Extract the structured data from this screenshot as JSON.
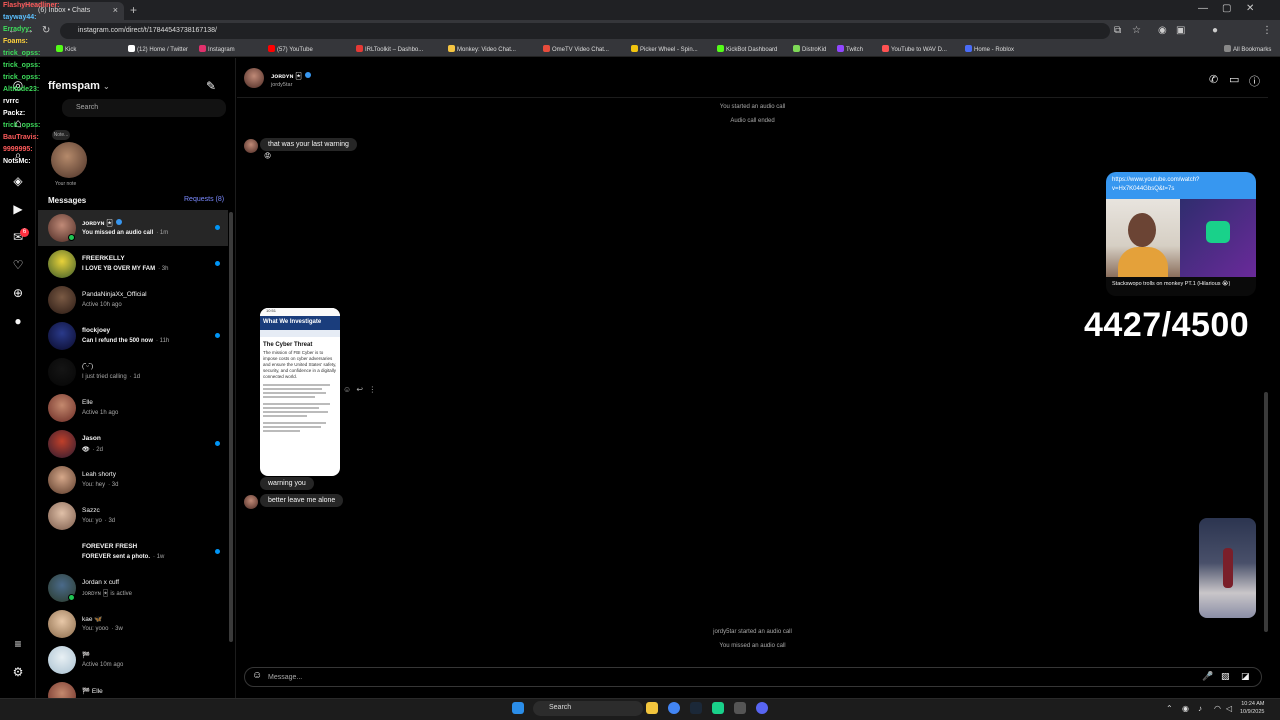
{
  "browser": {
    "tab_title": "(6) Inbox • Chats",
    "new_tab": "+",
    "url": "instagram.com/direct/t/17844543738167138/",
    "bookmarks": [
      {
        "label": "Kick",
        "color": "#53fc18"
      },
      {
        "label": "(12) Home / Twitter",
        "color": "#ffffff"
      },
      {
        "label": "Instagram",
        "color": "#e1306c"
      },
      {
        "label": "(57) YouTube",
        "color": "#ff0000"
      },
      {
        "label": "IRLToolkit – Dashbo...",
        "color": "#e53935"
      },
      {
        "label": "Monkey: Video Chat...",
        "color": "#f5c542"
      },
      {
        "label": "OmeTV Video Chat...",
        "color": "#e74c3c"
      },
      {
        "label": "Picker Wheel - Spin...",
        "color": "#f1c40f"
      },
      {
        "label": "KickBot Dashboard",
        "color": "#53fc18"
      },
      {
        "label": "DistroKid",
        "color": "#7ed957"
      },
      {
        "label": "Twitch",
        "color": "#9146ff"
      },
      {
        "label": "YouTube to WAV D...",
        "color": "#ff5252"
      },
      {
        "label": "Home - Roblox",
        "color": "#4a6cf7"
      }
    ],
    "all_bookmarks": "All Bookmarks"
  },
  "stream_chat": [
    {
      "name": "FlashyHeadliner:",
      "color": "#ff5b5b"
    },
    {
      "name": "tayway44:",
      "color": "#5bc0ff"
    },
    {
      "name": "Erradyy:",
      "color": "#3ddc5b"
    },
    {
      "name": "Foams:",
      "color": "#ffd23d"
    },
    {
      "name": "trick_opss:",
      "color": "#3ddc5b"
    },
    {
      "name": "trick_opss:",
      "color": "#3ddc5b"
    },
    {
      "name": "trick_opss:",
      "color": "#3ddc5b"
    },
    {
      "name": "Altitude23:",
      "color": "#3ddc5b"
    },
    {
      "name": "rvrrc",
      "color": "#ffffff"
    },
    {
      "name": "Packz:",
      "color": "#ffffff"
    },
    {
      "name": "trick_opss:",
      "color": "#3ddc5b"
    },
    {
      "name": "BauTravis:",
      "color": "#ff5b5b"
    },
    {
      "name": "9999995:",
      "color": "#ff5b5b"
    },
    {
      "name": "NotsMc:",
      "color": "#ffffff"
    }
  ],
  "sidebar": {
    "username": "ffemspam",
    "search_placeholder": "Search",
    "note_label": "Note...",
    "your_note": "Your note",
    "messages_title": "Messages",
    "requests": "Requests (8)",
    "notif_count": "6"
  },
  "chats": [
    {
      "name": "ᴊᴏʀᴅʏɴ 🃏",
      "sub": "You missed an audio call",
      "time": "· 1m",
      "unread": true,
      "active": true,
      "online": true,
      "verified": true,
      "avatar": [
        "#c08a77",
        "#4c2a24"
      ]
    },
    {
      "name": "FREERKELLY",
      "sub": "I LOVE YB OVER MY FAM",
      "time": "· 3h",
      "unread": true,
      "active": false,
      "online": false,
      "verified": false,
      "avatar": [
        "#e8d23a",
        "#3a5a2a"
      ]
    },
    {
      "name": "PandaNinjaXx_Official",
      "sub": "Active 10h ago",
      "time": "",
      "unread": false,
      "active": false,
      "online": false,
      "verified": false,
      "avatar": [
        "#7a5a44",
        "#2a1a14"
      ]
    },
    {
      "name": "flockjoey",
      "sub": "Can I refund the 500 now",
      "time": "· 11h",
      "unread": true,
      "active": false,
      "online": false,
      "verified": false,
      "avatar": [
        "#2a3a8a",
        "#0a0a2a"
      ]
    },
    {
      "name": "(˘ᵕ˘)",
      "sub": "I just tried calling",
      "time": "· 1d",
      "unread": false,
      "active": false,
      "online": false,
      "verified": false,
      "avatar": [
        "#151515",
        "#050505"
      ]
    },
    {
      "name": "Elle",
      "sub": "Active 1h ago",
      "time": "",
      "unread": false,
      "active": false,
      "online": false,
      "verified": false,
      "avatar": [
        "#c4896e",
        "#6a2a24"
      ]
    },
    {
      "name": "Jason",
      "sub": "👁",
      "time": "· 2d",
      "unread": true,
      "active": false,
      "online": false,
      "verified": false,
      "avatar": [
        "#c0402a",
        "#2a1a30"
      ]
    },
    {
      "name": "Leah shorty",
      "sub": "You: hey",
      "time": "· 3d",
      "unread": false,
      "active": false,
      "online": false,
      "verified": false,
      "avatar": [
        "#d6a88a",
        "#5a3a2a"
      ]
    },
    {
      "name": "Sazzc",
      "sub": "You: yo",
      "time": "· 3d",
      "unread": false,
      "active": false,
      "online": false,
      "verified": false,
      "avatar": [
        "#e0c0a8",
        "#7a5a4a"
      ]
    },
    {
      "name": "FOREVER FRESH",
      "sub": "FOREVER sent a photo.",
      "time": "· 1w",
      "unread": true,
      "active": false,
      "online": false,
      "verified": false,
      "avatar": [
        "#000000",
        "#000000"
      ]
    },
    {
      "name": "Jordan x cuff",
      "sub": "ᴊᴏʀᴅʏɴ 🃏 is active",
      "time": "",
      "unread": false,
      "active": false,
      "online": true,
      "verified": false,
      "avatar": [
        "#4a6a8a",
        "#2a3a2a"
      ]
    },
    {
      "name": "kae 🦋",
      "sub": "You: yooo",
      "time": "· 3w",
      "unread": false,
      "active": false,
      "online": false,
      "verified": false,
      "avatar": [
        "#e8c8a8",
        "#8a6a4a"
      ]
    },
    {
      "name": "🏁",
      "sub": "Active 10m ago",
      "time": "",
      "unread": false,
      "active": false,
      "online": false,
      "verified": false,
      "avatar": [
        "#e8f0f4",
        "#a8c0d0"
      ]
    },
    {
      "name": "🏁 Elle",
      "sub": "",
      "time": "",
      "unread": false,
      "active": false,
      "online": false,
      "verified": false,
      "avatar": [
        "#c4896e",
        "#6a2a24"
      ]
    }
  ],
  "conversation": {
    "name": "ᴊᴏʀᴅʏɴ 🃏",
    "handle": "jordy5tar",
    "system_top_1": "You started an audio call",
    "system_top_2": "Audio call ended",
    "msg_1": "that was your last warning",
    "reaction_1": "😡",
    "screenshot": {
      "status": "10:51",
      "banner": "What We Investigate",
      "heading": "The Cyber Threat",
      "body": "The mission of FBI Cyber is to impose costs on cyber adversaries and ensure the United States' safety, security, and confidence in a digitally connected world."
    },
    "msg_2": "warning you",
    "msg_3": "better leave me alone",
    "link_url": "https://www.youtube.com/watch?v=Hx7K044GbsQ&t=7s",
    "link_caption": "Stackswopo trolls on monkey PT.1 (Hilarious 😭)",
    "system_bottom_1": "jordy5tar started an audio call",
    "system_bottom_2": "You missed an audio call",
    "composer_placeholder": "Message..."
  },
  "overlay": {
    "counter": "4427/4500"
  },
  "taskbar": {
    "search": "Search",
    "time": "10:24 AM",
    "date": "10/9/2025"
  }
}
